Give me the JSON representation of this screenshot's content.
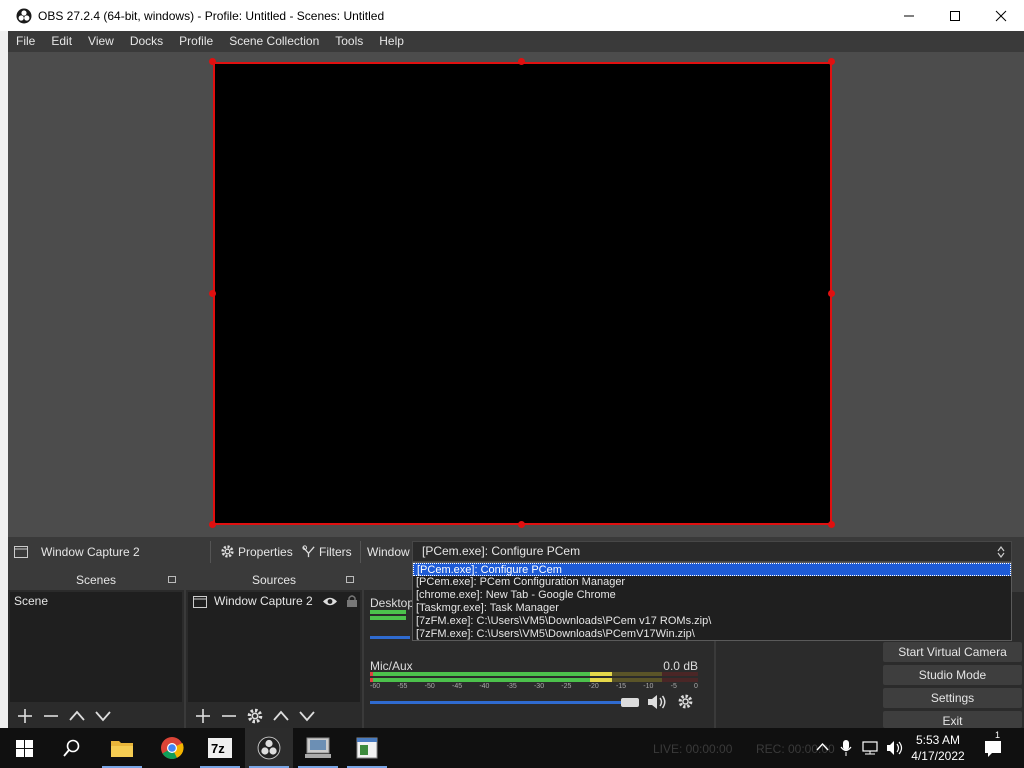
{
  "window": {
    "title": "OBS 27.2.4 (64-bit, windows) - Profile: Untitled - Scenes: Untitled"
  },
  "menu": [
    "File",
    "Edit",
    "View",
    "Docks",
    "Profile",
    "Scene Collection",
    "Tools",
    "Help"
  ],
  "source_toolbar": {
    "source_name": "Window Capture 2",
    "properties_label": "Properties",
    "filters_label": "Filters",
    "window_label": "Window",
    "window_value": "[PCem.exe]: Configure PCem"
  },
  "window_dropdown": {
    "options": [
      "[PCem.exe]: Configure PCem",
      "[PCem.exe]: PCem Configuration Manager",
      "[chrome.exe]: New Tab - Google Chrome",
      "[Taskmgr.exe]: Task Manager",
      "[7zFM.exe]: C:\\Users\\VM5\\Downloads\\PCem v17 ROMs.zip\\",
      "[7zFM.exe]: C:\\Users\\VM5\\Downloads\\PCemV17Win.zip\\"
    ],
    "selected_index": 0
  },
  "scenes_dock": {
    "title": "Scenes",
    "items": [
      "Scene"
    ]
  },
  "sources_dock": {
    "title": "Sources",
    "items": [
      "Window Capture 2"
    ]
  },
  "mixer": {
    "desktop_label": "Desktop A",
    "mic_label": "Mic/Aux",
    "mic_level": "0.0 dB",
    "ticks": [
      "-60",
      "-55",
      "-50",
      "-45",
      "-40",
      "-35",
      "-30",
      "-25",
      "-20",
      "-15",
      "-10",
      "-5",
      "0"
    ]
  },
  "controls": [
    "Start Virtual Camera",
    "Studio Mode",
    "Settings",
    "Exit"
  ],
  "statusbar": {
    "live": "LIVE: 00:00:00",
    "rec": "REC: 00:00:00"
  },
  "taskbar": {
    "apps": [
      "windows-start",
      "search",
      "file-explorer",
      "chrome",
      "7zip",
      "obs",
      "pcem",
      "notepad"
    ],
    "time": "5:53 AM",
    "date": "4/17/2022"
  },
  "colors": {
    "accent_red": "#e01010",
    "selection_blue": "#1e5bd6",
    "obs_bg": "#3a3a3a"
  }
}
